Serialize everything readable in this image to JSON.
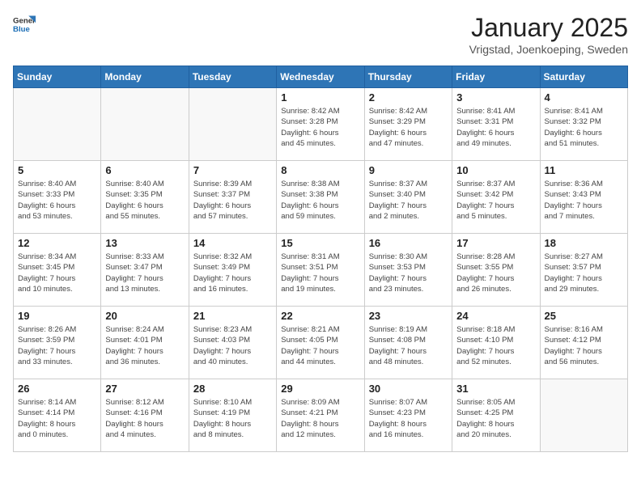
{
  "header": {
    "logo_general": "General",
    "logo_blue": "Blue",
    "month": "January 2025",
    "location": "Vrigstad, Joenkoeping, Sweden"
  },
  "weekdays": [
    "Sunday",
    "Monday",
    "Tuesday",
    "Wednesday",
    "Thursday",
    "Friday",
    "Saturday"
  ],
  "weeks": [
    [
      {
        "day": "",
        "info": ""
      },
      {
        "day": "",
        "info": ""
      },
      {
        "day": "",
        "info": ""
      },
      {
        "day": "1",
        "info": "Sunrise: 8:42 AM\nSunset: 3:28 PM\nDaylight: 6 hours\nand 45 minutes."
      },
      {
        "day": "2",
        "info": "Sunrise: 8:42 AM\nSunset: 3:29 PM\nDaylight: 6 hours\nand 47 minutes."
      },
      {
        "day": "3",
        "info": "Sunrise: 8:41 AM\nSunset: 3:31 PM\nDaylight: 6 hours\nand 49 minutes."
      },
      {
        "day": "4",
        "info": "Sunrise: 8:41 AM\nSunset: 3:32 PM\nDaylight: 6 hours\nand 51 minutes."
      }
    ],
    [
      {
        "day": "5",
        "info": "Sunrise: 8:40 AM\nSunset: 3:33 PM\nDaylight: 6 hours\nand 53 minutes."
      },
      {
        "day": "6",
        "info": "Sunrise: 8:40 AM\nSunset: 3:35 PM\nDaylight: 6 hours\nand 55 minutes."
      },
      {
        "day": "7",
        "info": "Sunrise: 8:39 AM\nSunset: 3:37 PM\nDaylight: 6 hours\nand 57 minutes."
      },
      {
        "day": "8",
        "info": "Sunrise: 8:38 AM\nSunset: 3:38 PM\nDaylight: 6 hours\nand 59 minutes."
      },
      {
        "day": "9",
        "info": "Sunrise: 8:37 AM\nSunset: 3:40 PM\nDaylight: 7 hours\nand 2 minutes."
      },
      {
        "day": "10",
        "info": "Sunrise: 8:37 AM\nSunset: 3:42 PM\nDaylight: 7 hours\nand 5 minutes."
      },
      {
        "day": "11",
        "info": "Sunrise: 8:36 AM\nSunset: 3:43 PM\nDaylight: 7 hours\nand 7 minutes."
      }
    ],
    [
      {
        "day": "12",
        "info": "Sunrise: 8:34 AM\nSunset: 3:45 PM\nDaylight: 7 hours\nand 10 minutes."
      },
      {
        "day": "13",
        "info": "Sunrise: 8:33 AM\nSunset: 3:47 PM\nDaylight: 7 hours\nand 13 minutes."
      },
      {
        "day": "14",
        "info": "Sunrise: 8:32 AM\nSunset: 3:49 PM\nDaylight: 7 hours\nand 16 minutes."
      },
      {
        "day": "15",
        "info": "Sunrise: 8:31 AM\nSunset: 3:51 PM\nDaylight: 7 hours\nand 19 minutes."
      },
      {
        "day": "16",
        "info": "Sunrise: 8:30 AM\nSunset: 3:53 PM\nDaylight: 7 hours\nand 23 minutes."
      },
      {
        "day": "17",
        "info": "Sunrise: 8:28 AM\nSunset: 3:55 PM\nDaylight: 7 hours\nand 26 minutes."
      },
      {
        "day": "18",
        "info": "Sunrise: 8:27 AM\nSunset: 3:57 PM\nDaylight: 7 hours\nand 29 minutes."
      }
    ],
    [
      {
        "day": "19",
        "info": "Sunrise: 8:26 AM\nSunset: 3:59 PM\nDaylight: 7 hours\nand 33 minutes."
      },
      {
        "day": "20",
        "info": "Sunrise: 8:24 AM\nSunset: 4:01 PM\nDaylight: 7 hours\nand 36 minutes."
      },
      {
        "day": "21",
        "info": "Sunrise: 8:23 AM\nSunset: 4:03 PM\nDaylight: 7 hours\nand 40 minutes."
      },
      {
        "day": "22",
        "info": "Sunrise: 8:21 AM\nSunset: 4:05 PM\nDaylight: 7 hours\nand 44 minutes."
      },
      {
        "day": "23",
        "info": "Sunrise: 8:19 AM\nSunset: 4:08 PM\nDaylight: 7 hours\nand 48 minutes."
      },
      {
        "day": "24",
        "info": "Sunrise: 8:18 AM\nSunset: 4:10 PM\nDaylight: 7 hours\nand 52 minutes."
      },
      {
        "day": "25",
        "info": "Sunrise: 8:16 AM\nSunset: 4:12 PM\nDaylight: 7 hours\nand 56 minutes."
      }
    ],
    [
      {
        "day": "26",
        "info": "Sunrise: 8:14 AM\nSunset: 4:14 PM\nDaylight: 8 hours\nand 0 minutes."
      },
      {
        "day": "27",
        "info": "Sunrise: 8:12 AM\nSunset: 4:16 PM\nDaylight: 8 hours\nand 4 minutes."
      },
      {
        "day": "28",
        "info": "Sunrise: 8:10 AM\nSunset: 4:19 PM\nDaylight: 8 hours\nand 8 minutes."
      },
      {
        "day": "29",
        "info": "Sunrise: 8:09 AM\nSunset: 4:21 PM\nDaylight: 8 hours\nand 12 minutes."
      },
      {
        "day": "30",
        "info": "Sunrise: 8:07 AM\nSunset: 4:23 PM\nDaylight: 8 hours\nand 16 minutes."
      },
      {
        "day": "31",
        "info": "Sunrise: 8:05 AM\nSunset: 4:25 PM\nDaylight: 8 hours\nand 20 minutes."
      },
      {
        "day": "",
        "info": ""
      }
    ]
  ]
}
